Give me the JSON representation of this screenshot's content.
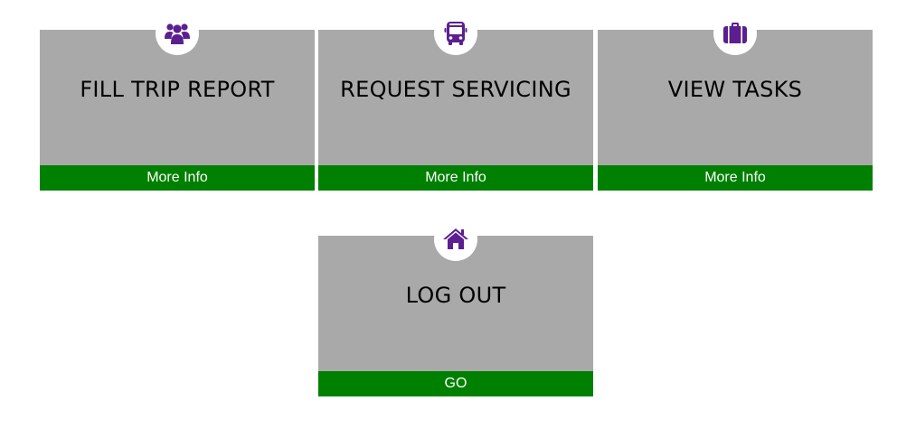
{
  "colors": {
    "tile_background": "#a9a9a9",
    "footer_background": "#008000",
    "icon_color": "#5b1f8f",
    "footer_text": "#ffffff"
  },
  "tiles": [
    {
      "title": "FILL TRIP REPORT",
      "icon": "users-icon",
      "action": "More Info"
    },
    {
      "title": "REQUEST SERVICING",
      "icon": "bus-icon",
      "action": "More Info"
    },
    {
      "title": "VIEW TASKS",
      "icon": "briefcase-icon",
      "action": "More Info"
    },
    {
      "title": "LOG OUT",
      "icon": "home-icon",
      "action": "GO"
    }
  ]
}
